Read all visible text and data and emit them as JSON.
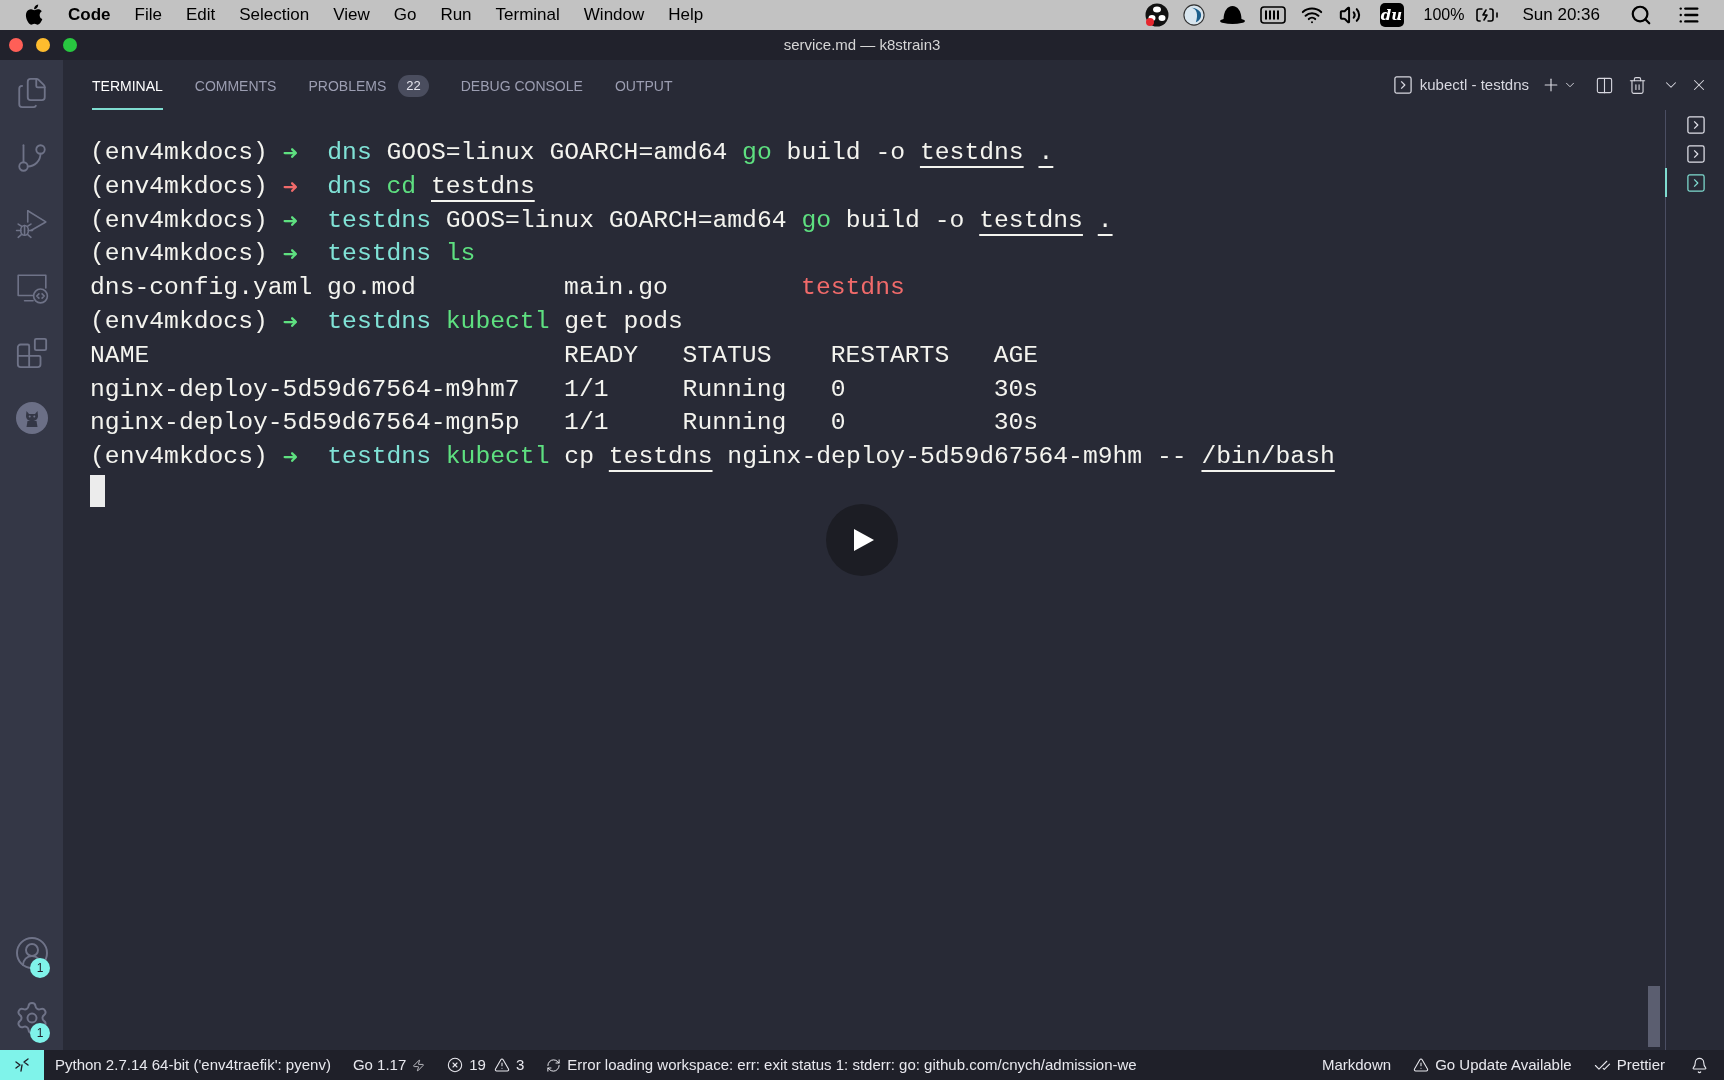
{
  "menu_bar": {
    "app_name": "Code",
    "menus": [
      "File",
      "Edit",
      "Selection",
      "View",
      "Go",
      "Run",
      "Terminal",
      "Window",
      "Help"
    ],
    "app_tile": "du",
    "battery": "100%",
    "clock": "Sun 20:36"
  },
  "window": {
    "title": "service.md — k8strain3"
  },
  "activity_bar": {
    "accounts_badge": "1",
    "manage_badge": "1"
  },
  "panel": {
    "tabs": [
      {
        "label": "TERMINAL",
        "selected": true
      },
      {
        "label": "COMMENTS",
        "selected": false
      },
      {
        "label": "PROBLEMS",
        "selected": false,
        "badge": "22"
      },
      {
        "label": "DEBUG CONSOLE",
        "selected": false
      },
      {
        "label": "OUTPUT",
        "selected": false
      }
    ],
    "terminal_picker": "kubectl - testdns"
  },
  "terminal": {
    "lines": [
      {
        "kind": "prompt",
        "env": "(env4mkdocs)",
        "arrow": "➜",
        "success": true,
        "directory": "dns",
        "tokens": [
          {
            "text": "GOOS=linux GOARCH=amd64",
            "kind": "arg"
          },
          {
            "text": "go",
            "kind": "command"
          },
          {
            "text": "build -o",
            "kind": "arg"
          },
          {
            "text": "testdns",
            "kind": "path"
          },
          {
            "text": ".",
            "kind": "path"
          }
        ]
      },
      {
        "kind": "prompt",
        "env": "(env4mkdocs)",
        "arrow": "➜",
        "success": false,
        "directory": "dns",
        "tokens": [
          {
            "text": "cd",
            "kind": "command"
          },
          {
            "text": "testdns",
            "kind": "path"
          }
        ]
      },
      {
        "kind": "prompt",
        "env": "(env4mkdocs)",
        "arrow": "➜",
        "success": true,
        "directory": "testdns",
        "tokens": [
          {
            "text": "GOOS=linux GOARCH=amd64",
            "kind": "arg"
          },
          {
            "text": "go",
            "kind": "command"
          },
          {
            "text": "build -o",
            "kind": "arg"
          },
          {
            "text": "testdns",
            "kind": "path"
          },
          {
            "text": ".",
            "kind": "path"
          }
        ]
      },
      {
        "kind": "prompt",
        "env": "(env4mkdocs)",
        "arrow": "➜",
        "success": true,
        "directory": "testdns",
        "tokens": [
          {
            "text": "ls",
            "kind": "command"
          }
        ]
      },
      {
        "kind": "listing",
        "entries": [
          {
            "text": "dns-config.yaml",
            "kind": "file"
          },
          {
            "text": "go.mod",
            "kind": "file"
          },
          {
            "text": "main.go",
            "kind": "file"
          },
          {
            "text": "testdns",
            "kind": "executable"
          }
        ]
      },
      {
        "kind": "prompt",
        "env": "(env4mkdocs)",
        "arrow": "➜",
        "success": true,
        "directory": "testdns",
        "tokens": [
          {
            "text": "kubectl",
            "kind": "command"
          },
          {
            "text": "get pods",
            "kind": "arg"
          }
        ]
      },
      {
        "kind": "table",
        "columns": [
          "NAME",
          "READY",
          "STATUS",
          "RESTARTS",
          "AGE"
        ],
        "rows": [
          [
            "nginx-deploy-5d59d67564-m9hm7",
            "1/1",
            "Running",
            "0",
            "30s"
          ],
          [
            "nginx-deploy-5d59d67564-mgn5p",
            "1/1",
            "Running",
            "0",
            "30s"
          ]
        ]
      },
      {
        "kind": "prompt",
        "env": "(env4mkdocs)",
        "arrow": "➜",
        "success": true,
        "directory": "testdns",
        "tokens": [
          {
            "text": "kubectl",
            "kind": "command"
          },
          {
            "text": "cp",
            "kind": "arg"
          },
          {
            "text": "testdns",
            "kind": "path"
          },
          {
            "text": "nginx-deploy-5d59d67564-m9hm --",
            "kind": "arg"
          },
          {
            "text": "/bin/bash",
            "kind": "path"
          }
        ]
      }
    ]
  },
  "terminal_tabs": [
    {
      "selected": false
    },
    {
      "selected": false
    },
    {
      "selected": true
    }
  ],
  "status_bar": {
    "python": "Python 2.7.14 64-bit ('env4traefik': pyenv)",
    "go_version": "Go 1.17",
    "errors": "19",
    "warnings": "3",
    "workspace_message": "Error loading workspace: err: exit status 1: stderr: go: github.com/cnych/admission-we",
    "language": "Markdown",
    "update_notice": "Go Update Available",
    "formatter": "Prettier"
  }
}
